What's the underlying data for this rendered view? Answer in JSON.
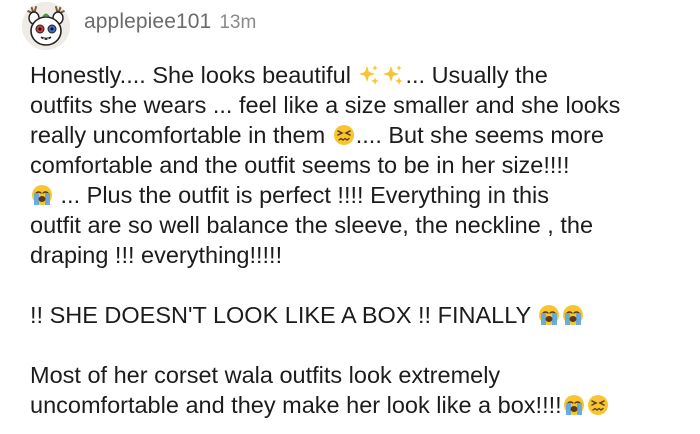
{
  "comment": {
    "username": "applepiee101",
    "time": "13m",
    "avatar_icon": "cartoon-animal-avatar-icon",
    "paragraphs": [
      {
        "lines": [
          [
            {
              "t": "Honestly.... She looks beautiful "
            },
            {
              "e": "sparkles"
            },
            {
              "e": "sparkles"
            },
            {
              "t": "... Usually the"
            }
          ],
          [
            {
              "t": "outfits she wears ... feel like a size smaller and she looks"
            }
          ],
          [
            {
              "t": "really uncomfortable in them "
            },
            {
              "e": "persevering"
            },
            {
              "t": ".... But she seems more"
            }
          ],
          [
            {
              "t": "comfortable and the outfit seems to be in her size!!!!"
            }
          ],
          [
            {
              "e": "crying"
            },
            {
              "t": " ... Plus the outfit is perfect !!!! Everything in this"
            }
          ],
          [
            {
              "t": "outfit are so well balance the sleeve, the neckline , the"
            }
          ],
          [
            {
              "t": "draping !!! everything!!!!!"
            }
          ]
        ]
      },
      {
        "lines": [
          [
            {
              "t": "!! SHE DOESN'T LOOK LIKE A BOX !! FINALLY "
            },
            {
              "e": "crying"
            },
            {
              "e": "crying"
            }
          ]
        ]
      },
      {
        "lines": [
          [
            {
              "t": "Most of her corset wala outfits look extremely"
            }
          ],
          [
            {
              "t": "uncomfortable and they make her look like a box!!!!"
            },
            {
              "e": "crying"
            },
            {
              "e": "persevering"
            }
          ]
        ]
      }
    ]
  },
  "colors": {
    "username": "#6b6b6b",
    "time": "#8a8a8a",
    "text": "#1c1c1c",
    "emoji_yellow": "#f7c531",
    "tear_blue": "#5aa6e8"
  }
}
